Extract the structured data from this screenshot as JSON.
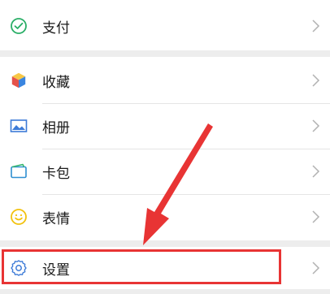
{
  "menu": {
    "pay": {
      "label": "支付",
      "icon": "wechat-pay-icon"
    },
    "favorites": {
      "label": "收藏",
      "icon": "cube-icon"
    },
    "album": {
      "label": "相册",
      "icon": "picture-icon"
    },
    "cards": {
      "label": "卡包",
      "icon": "card-icon"
    },
    "stickers": {
      "label": "表情",
      "icon": "smiley-icon"
    },
    "settings": {
      "label": "设置",
      "icon": "gear-icon"
    }
  },
  "colors": {
    "background": "#ededed",
    "row": "#ffffff",
    "chevron": "#b2b2b2",
    "annotation": "#e83434",
    "pay_green": "#2aae67",
    "album_blue": "#3d7bd7",
    "sticker_yellow": "#f2c20f"
  }
}
